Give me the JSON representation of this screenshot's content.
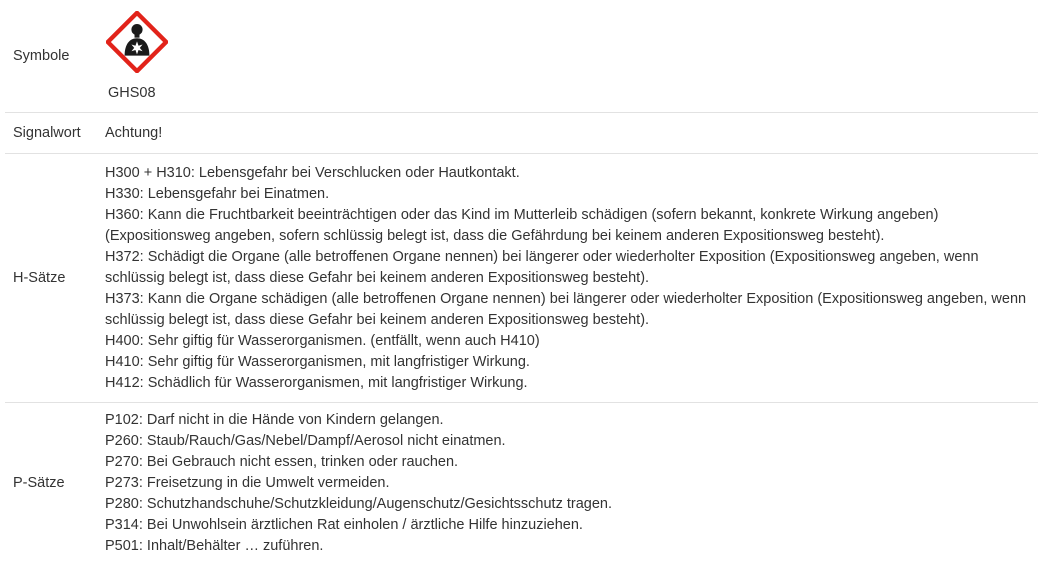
{
  "rows": {
    "symbole": {
      "label": "Symbole",
      "icon": "ghs08-health-hazard-icon",
      "icon_caption": "GHS08",
      "colors": {
        "border": "#e2231a",
        "symbol": "#1a1a1a"
      }
    },
    "signalwort": {
      "label": "Signalwort",
      "value": "Achtung!"
    },
    "h_saetze": {
      "label": "H-Sätze",
      "items": [
        "H300 + H310: Lebensgefahr bei Verschlucken oder Hautkontakt.",
        "H330: Lebensgefahr bei Einatmen.",
        "H360: Kann die Fruchtbarkeit beeinträchtigen oder das Kind im Mutterleib schädigen (sofern bekannt, konkrete Wirkung angeben) (Expositionsweg angeben, sofern schlüssig belegt ist, dass die Gefährdung bei keinem anderen Expositionsweg besteht).",
        "H372: Schädigt die Organe (alle betroffenen Organe nennen) bei längerer oder wiederholter Exposition (Expositionsweg angeben, wenn schlüssig belegt ist, dass diese Gefahr bei keinem anderen Expositionsweg besteht).",
        "H373: Kann die Organe schädigen (alle betroffenen Organe nennen) bei längerer oder wiederholter Exposition (Expositionsweg angeben, wenn schlüssig belegt ist, dass diese Gefahr bei keinem anderen Expositionsweg besteht).",
        "H400: Sehr giftig für Wasserorganismen. (entfällt, wenn auch H410)",
        "H410: Sehr giftig für Wasserorganismen, mit langfristiger Wirkung.",
        "H412: Schädlich für Wasserorganismen, mit langfristiger Wirkung."
      ]
    },
    "p_saetze": {
      "label": "P-Sätze",
      "items": [
        "P102: Darf nicht in die Hände von Kindern gelangen.",
        "P260: Staub/Rauch/Gas/Nebel/Dampf/Aerosol nicht einatmen.",
        "P270: Bei Gebrauch nicht essen, trinken oder rauchen.",
        "P273: Freisetzung in die Umwelt vermeiden.",
        "P280: Schutzhandschuhe/Schutzkleidung/Augenschutz/Gesichtsschutz tragen.",
        "P314: Bei Unwohlsein ärztlichen Rat einholen / ärztliche Hilfe hinzuziehen.",
        "P501: Inhalt/Behälter … zuführen."
      ]
    }
  }
}
